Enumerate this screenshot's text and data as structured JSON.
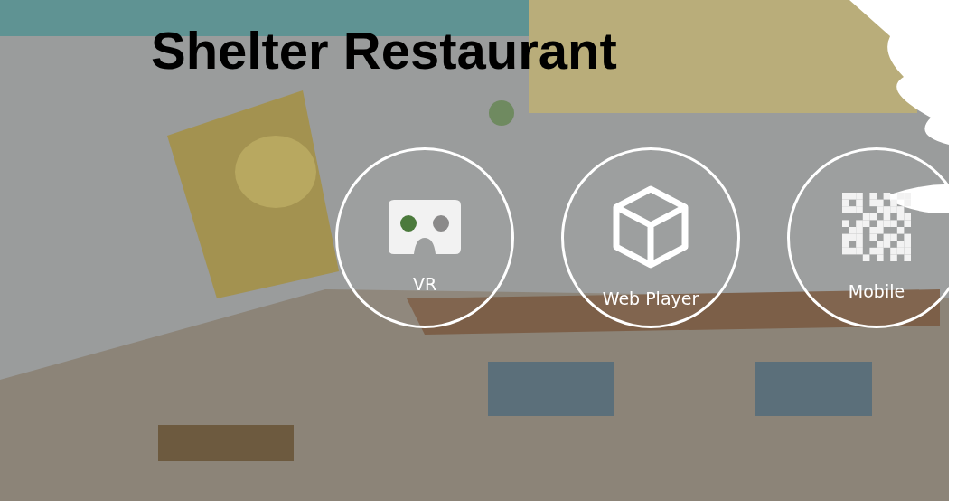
{
  "title": "Shelter Restaurant",
  "options": [
    {
      "kind": "vr",
      "label": "VR"
    },
    {
      "kind": "web",
      "label": "Web Player"
    },
    {
      "kind": "qr",
      "label": "Mobile"
    }
  ]
}
